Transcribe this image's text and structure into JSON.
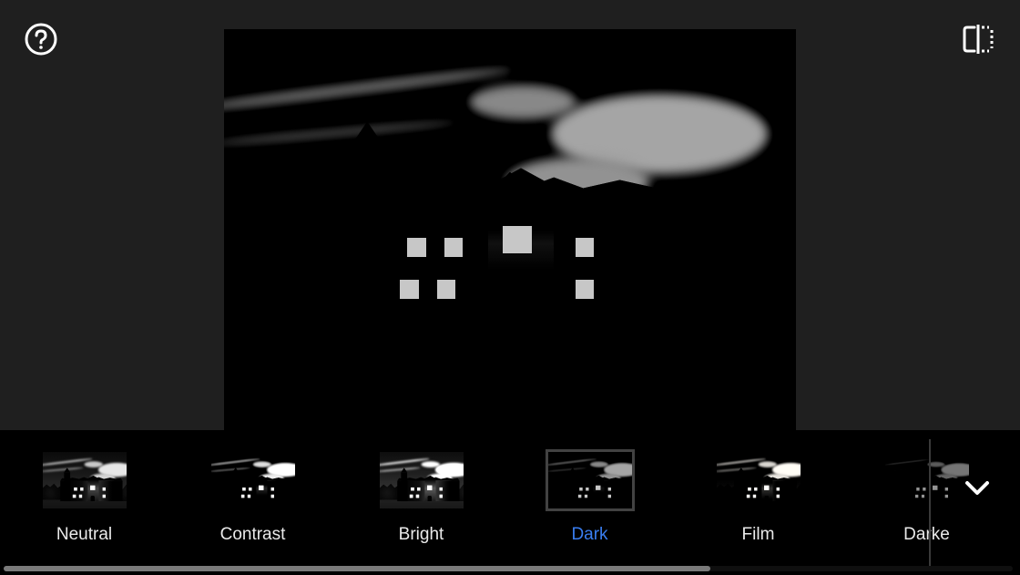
{
  "icons": {
    "help": "help-icon",
    "compare": "compare-icon",
    "chevron": "chevron-down-icon"
  },
  "selected_filter": "Dark",
  "filters": [
    {
      "label": "Neutral",
      "tone": "t-neutral",
      "selected": false
    },
    {
      "label": "Contrast",
      "tone": "t-contrast",
      "selected": false
    },
    {
      "label": "Bright",
      "tone": "t-bright",
      "selected": false
    },
    {
      "label": "Dark",
      "tone": "t-dark",
      "selected": true
    },
    {
      "label": "Film",
      "tone": "t-film",
      "selected": false
    },
    {
      "label": "Darke",
      "tone": "t-darke",
      "selected": false
    }
  ]
}
